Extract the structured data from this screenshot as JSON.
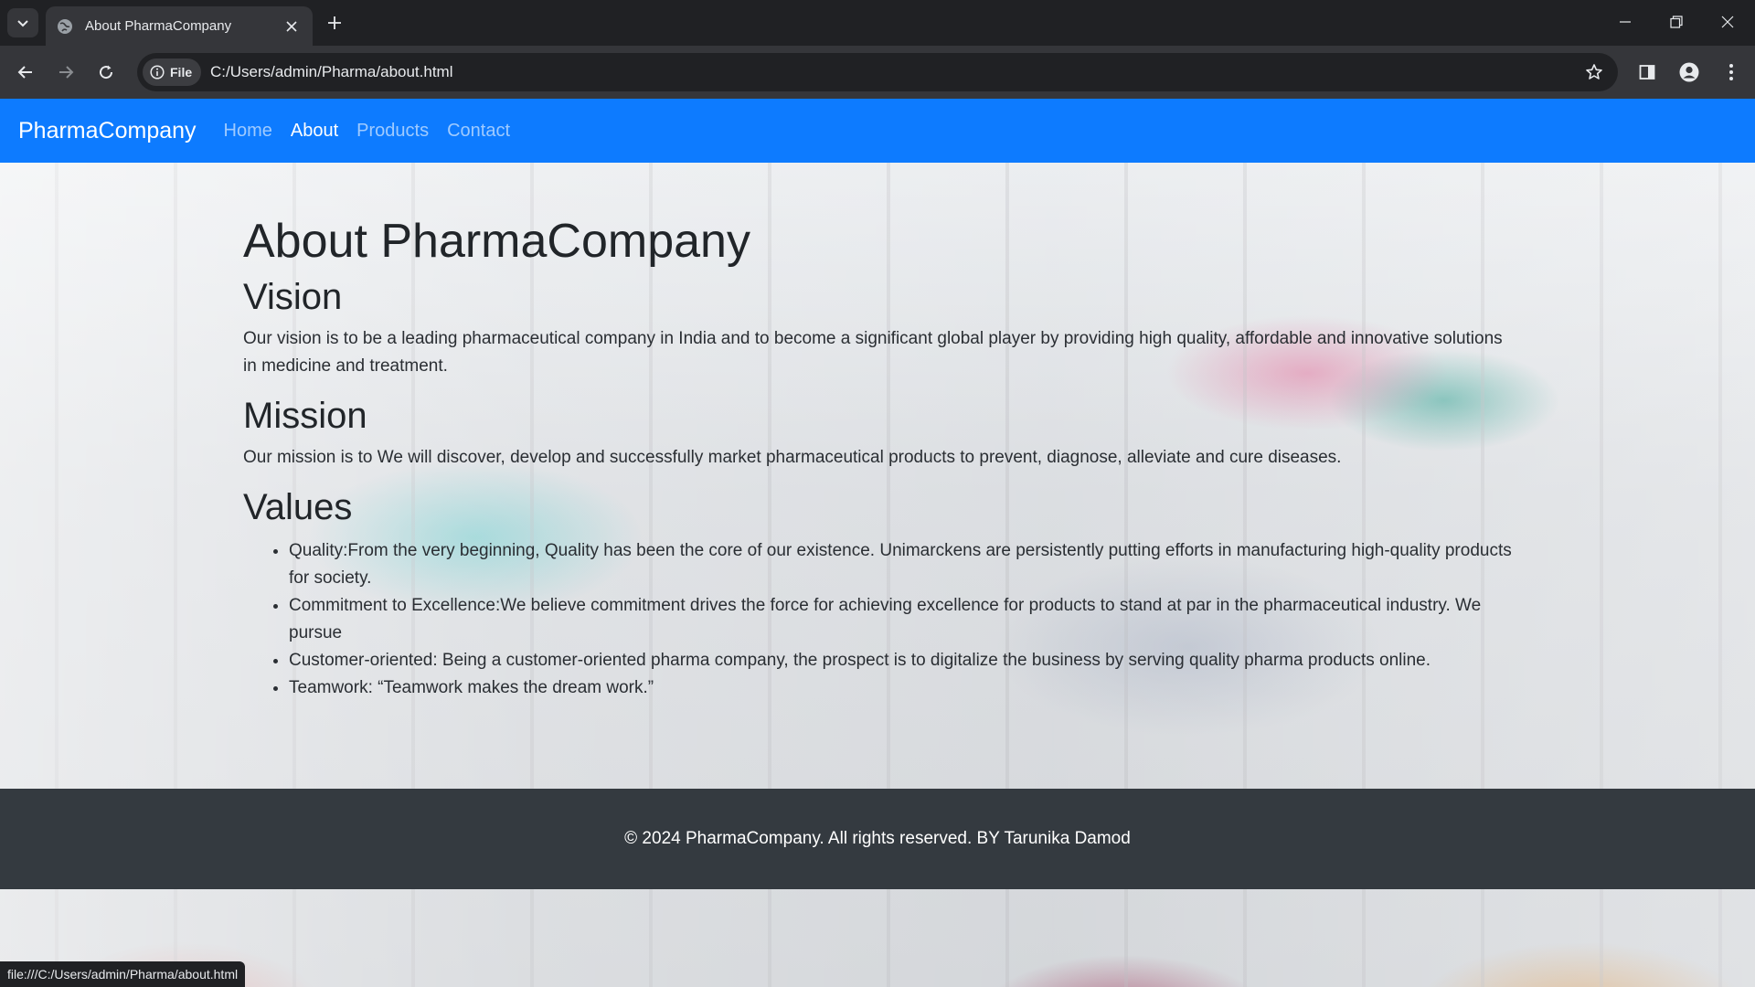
{
  "browser": {
    "tab_title": "About PharmaCompany",
    "site_chip_label": "File",
    "url": "C:/Users/admin/Pharma/about.html",
    "status_url": "file:///C:/Users/admin/Pharma/about.html"
  },
  "navbar": {
    "brand": "PharmaCompany",
    "links": [
      {
        "label": "Home",
        "active": false
      },
      {
        "label": "About",
        "active": true
      },
      {
        "label": "Products",
        "active": false
      },
      {
        "label": "Contact",
        "active": false
      }
    ],
    "color": "#0d7bff"
  },
  "main": {
    "title": "About PharmaCompany",
    "vision": {
      "heading": "Vision",
      "text": "Our vision is to be a leading pharmaceutical company in India and to become a significant global player by providing high quality, affordable and innovative solutions in medicine and treatment."
    },
    "mission": {
      "heading": "Mission",
      "text": "Our mission is to We will discover, develop and successfully market pharmaceutical products to prevent, diagnose, alleviate and cure diseases."
    },
    "values": {
      "heading": "Values",
      "items": [
        "Quality:From the very beginning, Quality has been the core of our existence. Unimarckens are persistently putting efforts in manufacturing high-quality products for society.",
        "Commitment to Excellence:We believe commitment drives the force for achieving excellence for products to stand at par in the pharmaceutical industry. We pursue",
        "Customer-oriented: Being a customer-oriented pharma company, the prospect is to digitalize the business by serving quality pharma products online.",
        "Teamwork: “Teamwork makes the dream work.”"
      ]
    }
  },
  "footer": {
    "text": "© 2024 PharmaCompany. All rights reserved. BY Tarunika Damod",
    "color": "#343a40"
  }
}
